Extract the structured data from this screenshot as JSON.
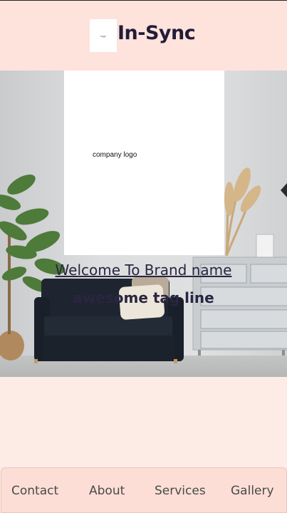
{
  "header": {
    "logo_placeholder": "logo",
    "title": "In-Sync"
  },
  "hero": {
    "logo_text": "company logo",
    "welcome": "Welcome To Brand name",
    "tagline": "awesome tag line"
  },
  "nav": {
    "items": [
      {
        "label": "Contact"
      },
      {
        "label": "About"
      },
      {
        "label": "Services"
      },
      {
        "label": "Gallery"
      }
    ]
  },
  "colors": {
    "background": "#fdebe6",
    "header_bg": "#fde3dc",
    "title": "#221c3a",
    "nav_bg": "#fcded6"
  }
}
